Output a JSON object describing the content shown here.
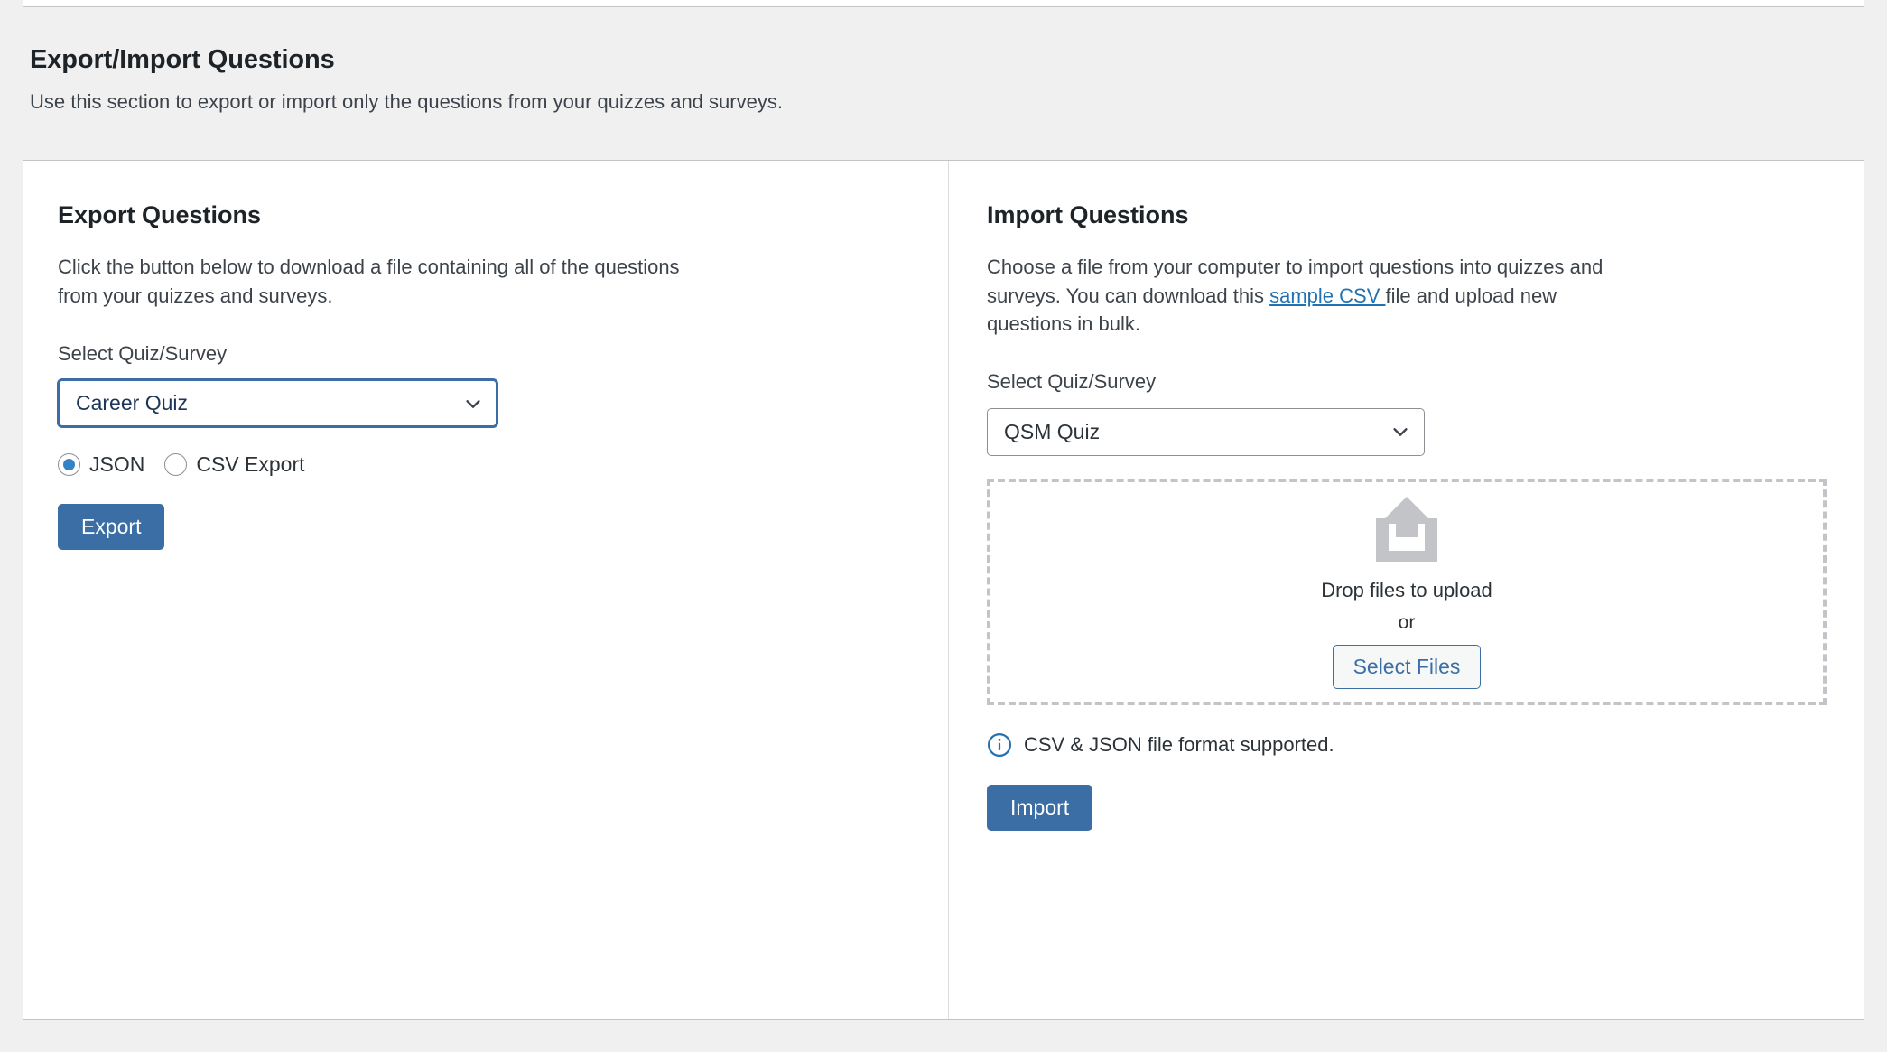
{
  "section": {
    "title": "Export/Import Questions",
    "description": "Use this section to export or import only the questions from your quizzes and surveys."
  },
  "export_panel": {
    "title": "Export Questions",
    "description": "Click the button below to download a file containing all of the questions from your quizzes and surveys.",
    "select_label": "Select Quiz/Survey",
    "select_value": "Career Quiz",
    "chevron_icon": "chevron-down-icon",
    "format_options": [
      {
        "label": "JSON",
        "checked": true
      },
      {
        "label": "CSV Export",
        "checked": false
      }
    ],
    "export_button": "Export"
  },
  "import_panel": {
    "title": "Import Questions",
    "description_before_link": "Choose a file from your computer to import questions into quizzes and surveys. You can download this ",
    "link_text": "sample CSV ",
    "description_after_link": "file and upload new questions in bulk.",
    "select_label": "Select Quiz/Survey",
    "select_value": "QSM Quiz",
    "chevron_icon": "chevron-down-icon",
    "dropzone": {
      "upload_icon": "upload-arrow-icon",
      "drop_text": "Drop files to upload",
      "or_text": "or",
      "select_files_button": "Select Files"
    },
    "info_icon": "info-circle-icon",
    "info_text": "CSV & JSON file format supported.",
    "import_button": "Import"
  },
  "colors": {
    "page_background": "#f0f0f1",
    "card_background": "#ffffff",
    "card_border": "#c3c4c7",
    "primary_button": "#3a6ea5",
    "link": "#2271b1",
    "radio_checked": "#3582c4",
    "dropzone_border": "#c3c4c7",
    "upload_icon": "#c3c4c7",
    "info_icon": "#2271b1",
    "text": "#1d2327"
  }
}
